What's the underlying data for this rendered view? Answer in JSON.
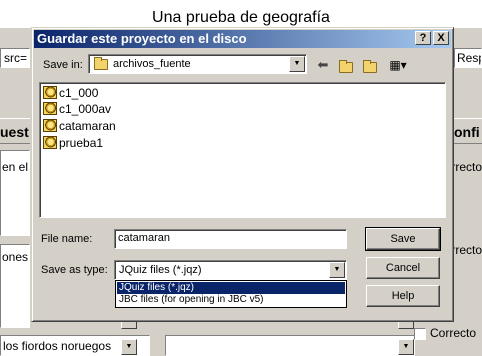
{
  "background": {
    "title": "Una prueba de geografía",
    "src_fragment": "src=",
    "resp_fragment": "Resp",
    "panel_left_fragment": "uest",
    "panel_right_fragment": "onfi",
    "line_en_el": "en el",
    "line_ones": "ones",
    "answer_text": "los fiordos noruegos",
    "correct_labels": [
      "Correcto",
      "Correcto",
      "Correcto"
    ]
  },
  "dialog": {
    "title": "Guardar este proyecto en el disco",
    "title_buttons": {
      "help": "?",
      "close": "X"
    },
    "save_in_label": "Save in:",
    "save_in_value": "archivos_fuente",
    "toolbar_icons": [
      "back-arrow-icon",
      "up-folder-icon",
      "new-folder-icon",
      "view-menu-icon"
    ],
    "files": [
      {
        "name": "c1_000",
        "icon": "project-file-icon"
      },
      {
        "name": "c1_000av",
        "icon": "project-file-icon"
      },
      {
        "name": "catamaran",
        "icon": "project-file-icon"
      },
      {
        "name": "prueba1",
        "icon": "project-file-icon"
      }
    ],
    "file_name_label": "File name:",
    "file_name_value": "catamaran",
    "save_as_type_label": "Save as type:",
    "save_as_type_value": "JQuiz files (*.jqz)",
    "type_options": [
      {
        "label": "JQuiz files (*.jqz)",
        "selected": true
      },
      {
        "label": "JBC files (for opening in JBC v5)",
        "selected": false
      }
    ],
    "buttons": {
      "save": "Save",
      "cancel": "Cancel",
      "help": "Help"
    }
  },
  "colors": {
    "titlebar_start": "#0a246a",
    "titlebar_end": "#a6caf0",
    "selection": "#0a246a",
    "face": "#d4d0c8"
  }
}
